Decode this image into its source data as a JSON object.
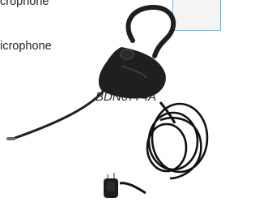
{
  "text": {
    "line_1": "crophone",
    "line_2": "icrophone",
    "model_code": "BDN6774A"
  },
  "colors": {
    "box_border": "#7fb6d3",
    "box_fill": "#f4f4f4",
    "text": "#222222",
    "earpiece": "#1f1f1f",
    "cable": "#111111"
  },
  "product_image": {
    "subject": "ear-microphone-headset-photo"
  }
}
